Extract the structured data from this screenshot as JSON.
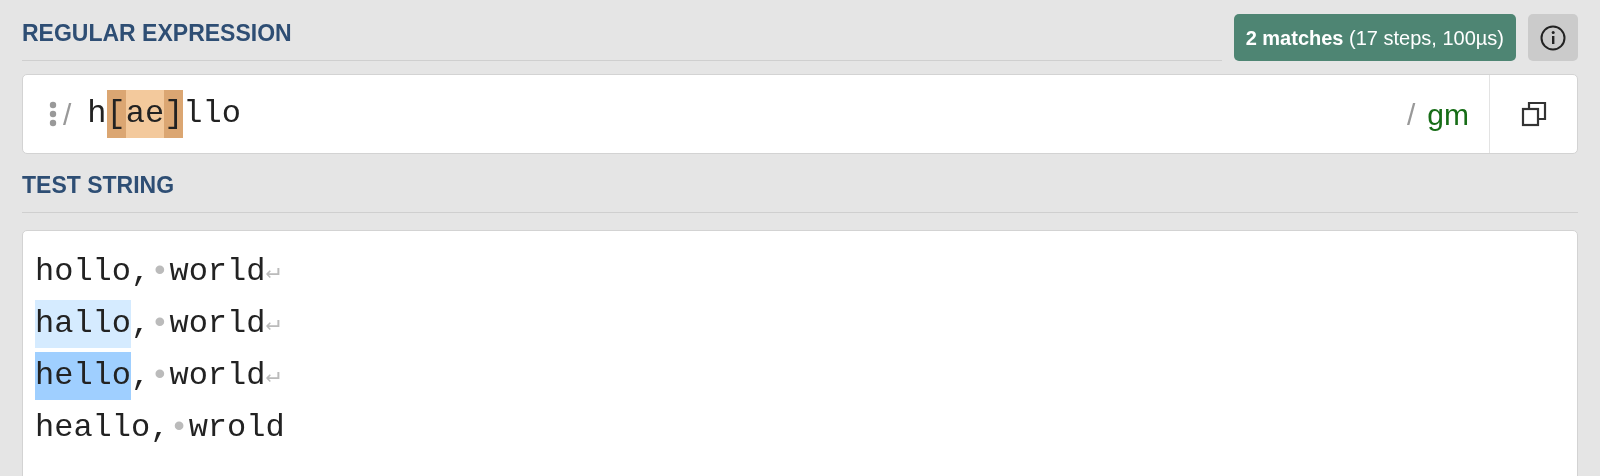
{
  "regex_section": {
    "title": "REGULAR EXPRESSION",
    "match_badge": {
      "count": "2 matches",
      "detail": "(17 steps, 100µs)"
    },
    "delimiter_open": "/",
    "pattern": [
      {
        "text": "h",
        "kind": "plain"
      },
      {
        "text": "[",
        "kind": "bracket"
      },
      {
        "text": "ae",
        "kind": "class"
      },
      {
        "text": "]",
        "kind": "bracket"
      },
      {
        "text": "llo",
        "kind": "plain"
      }
    ],
    "delimiter_close": "/",
    "flags": "gm"
  },
  "test_section": {
    "title": "TEST STRING",
    "lines": [
      [
        {
          "text": "hollo,",
          "kind": "plain"
        },
        {
          "text": "•",
          "kind": "space"
        },
        {
          "text": "world",
          "kind": "plain"
        },
        {
          "text": "↵",
          "kind": "eol"
        }
      ],
      [
        {
          "text": "hallo",
          "kind": "match",
          "color": "#d5ebff"
        },
        {
          "text": ",",
          "kind": "plain"
        },
        {
          "text": "•",
          "kind": "space"
        },
        {
          "text": "world",
          "kind": "plain"
        },
        {
          "text": "↵",
          "kind": "eol"
        }
      ],
      [
        {
          "text": "hello",
          "kind": "match",
          "color": "#9fcfff"
        },
        {
          "text": ",",
          "kind": "plain"
        },
        {
          "text": "•",
          "kind": "space"
        },
        {
          "text": "world",
          "kind": "plain"
        },
        {
          "text": "↵",
          "kind": "eol"
        }
      ],
      [
        {
          "text": "heallo,",
          "kind": "plain"
        },
        {
          "text": "•",
          "kind": "space"
        },
        {
          "text": "wrold",
          "kind": "plain"
        }
      ]
    ]
  }
}
